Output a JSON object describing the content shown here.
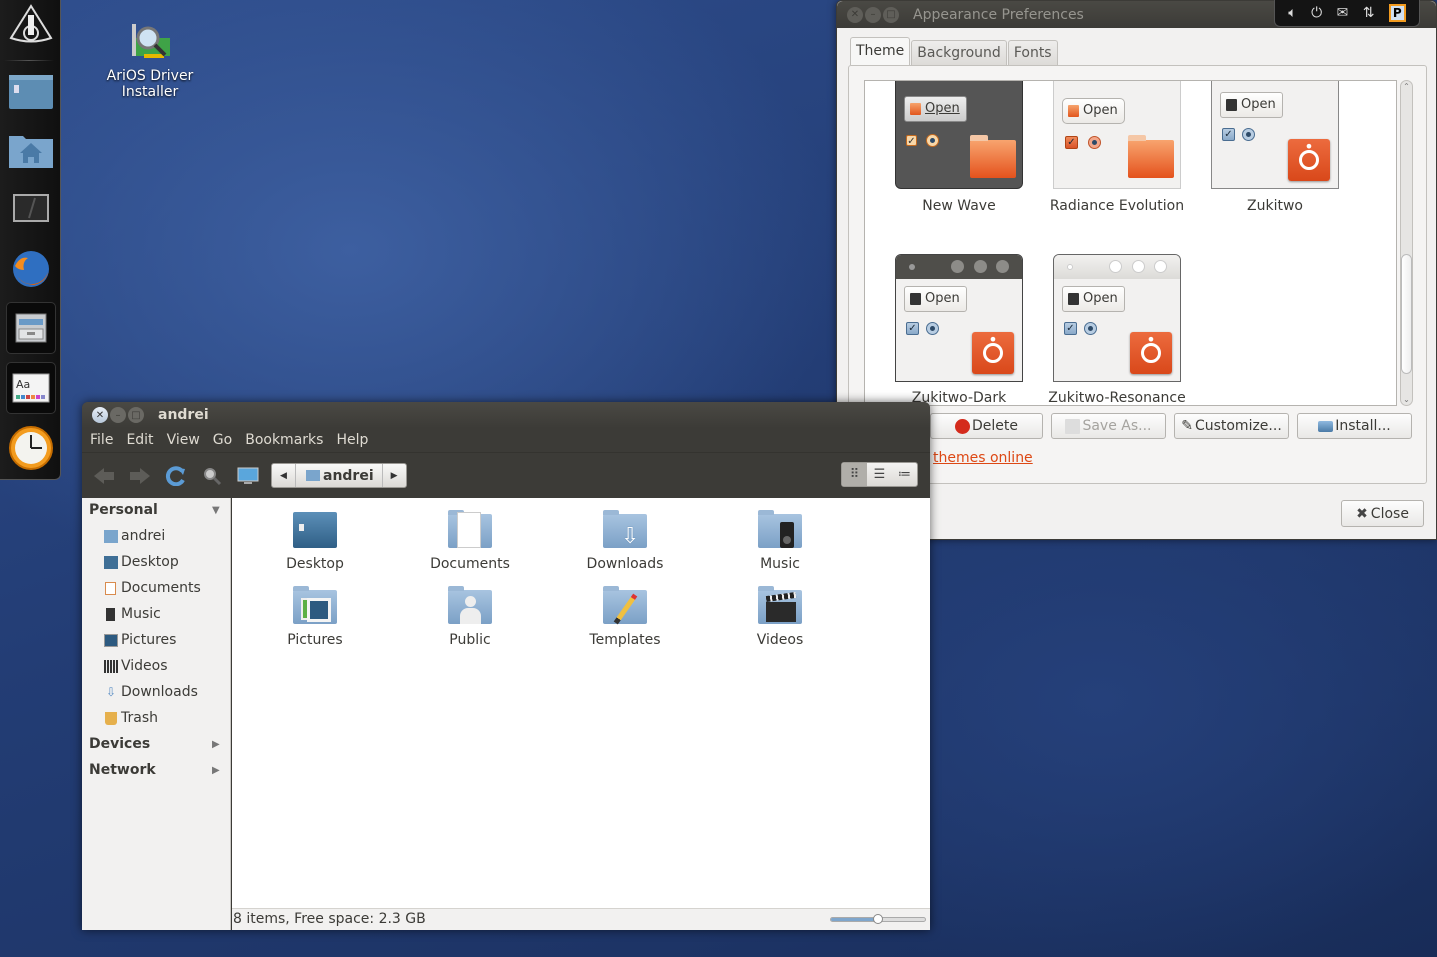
{
  "desktop": {
    "icons": [
      {
        "label": "AriOS Driver Installer",
        "icon": "driver-installer-icon"
      }
    ]
  },
  "dock": {
    "items": [
      {
        "name": "arios-logo",
        "icon": "arios-logo-icon"
      },
      {
        "name": "workspace-switcher",
        "icon": "workspace-icon"
      },
      {
        "name": "home-folder",
        "icon": "home-folder-icon"
      },
      {
        "name": "terminal",
        "icon": "terminal-icon"
      },
      {
        "name": "firefox",
        "icon": "firefox-icon"
      },
      {
        "name": "file-cabinet",
        "icon": "file-cabinet-icon"
      },
      {
        "name": "appearance",
        "icon": "appearance-icon"
      },
      {
        "name": "clock",
        "icon": "clock-icon"
      }
    ]
  },
  "tray": {
    "icons": [
      "volume-icon",
      "power-icon",
      "mail-icon",
      "network-icon",
      "clipboard-icon"
    ],
    "clipboard_letter": "P"
  },
  "appearance": {
    "title": "Appearance Preferences",
    "tabs": [
      {
        "label": "Theme",
        "active": true
      },
      {
        "label": "Background",
        "active": false
      },
      {
        "label": "Fonts",
        "active": false
      }
    ],
    "themes": [
      {
        "name": "New Wave",
        "open_label": "Open"
      },
      {
        "name": "Radiance Evolution",
        "open_label": "Open"
      },
      {
        "name": "Zukitwo",
        "open_label": "Open"
      },
      {
        "name": "Zukitwo-Dark",
        "open_label": "Open"
      },
      {
        "name": "Zukitwo-Resonance",
        "open_label": "Open"
      }
    ],
    "buttons": {
      "delete": "Delete",
      "save_as": "Save As...",
      "customize": "Customize...",
      "install": "Install..."
    },
    "link": "themes online",
    "close": "Close"
  },
  "nautilus": {
    "title": "andrei",
    "menu": [
      "File",
      "Edit",
      "View",
      "Go",
      "Bookmarks",
      "Help"
    ],
    "breadcrumb": "andrei",
    "sidebar": {
      "personal": "Personal",
      "items": [
        {
          "label": "andrei",
          "icon": "home-icon"
        },
        {
          "label": "Desktop",
          "icon": "desktop-icon"
        },
        {
          "label": "Documents",
          "icon": "documents-icon"
        },
        {
          "label": "Music",
          "icon": "music-icon"
        },
        {
          "label": "Pictures",
          "icon": "pictures-icon"
        },
        {
          "label": "Videos",
          "icon": "videos-icon"
        },
        {
          "label": "Downloads",
          "icon": "downloads-icon"
        },
        {
          "label": "Trash",
          "icon": "trash-icon"
        }
      ],
      "devices": "Devices",
      "network": "Network"
    },
    "files": [
      {
        "label": "Desktop",
        "icon": "desktop-folder-icon"
      },
      {
        "label": "Documents",
        "icon": "documents-folder-icon"
      },
      {
        "label": "Downloads",
        "icon": "downloads-folder-icon"
      },
      {
        "label": "Music",
        "icon": "music-folder-icon"
      },
      {
        "label": "Pictures",
        "icon": "pictures-folder-icon"
      },
      {
        "label": "Public",
        "icon": "public-folder-icon"
      },
      {
        "label": "Templates",
        "icon": "templates-folder-icon"
      },
      {
        "label": "Videos",
        "icon": "videos-folder-icon"
      }
    ],
    "status": "8 items, Free space: 2.3 GB",
    "zoom_level_fraction": 0.5,
    "view_mode": "icons"
  },
  "colors": {
    "accent": "#dd4814",
    "title_bar": "#3c3b37",
    "window_bg": "#f2f1f0",
    "folder_blue": "#7ba0c6"
  }
}
